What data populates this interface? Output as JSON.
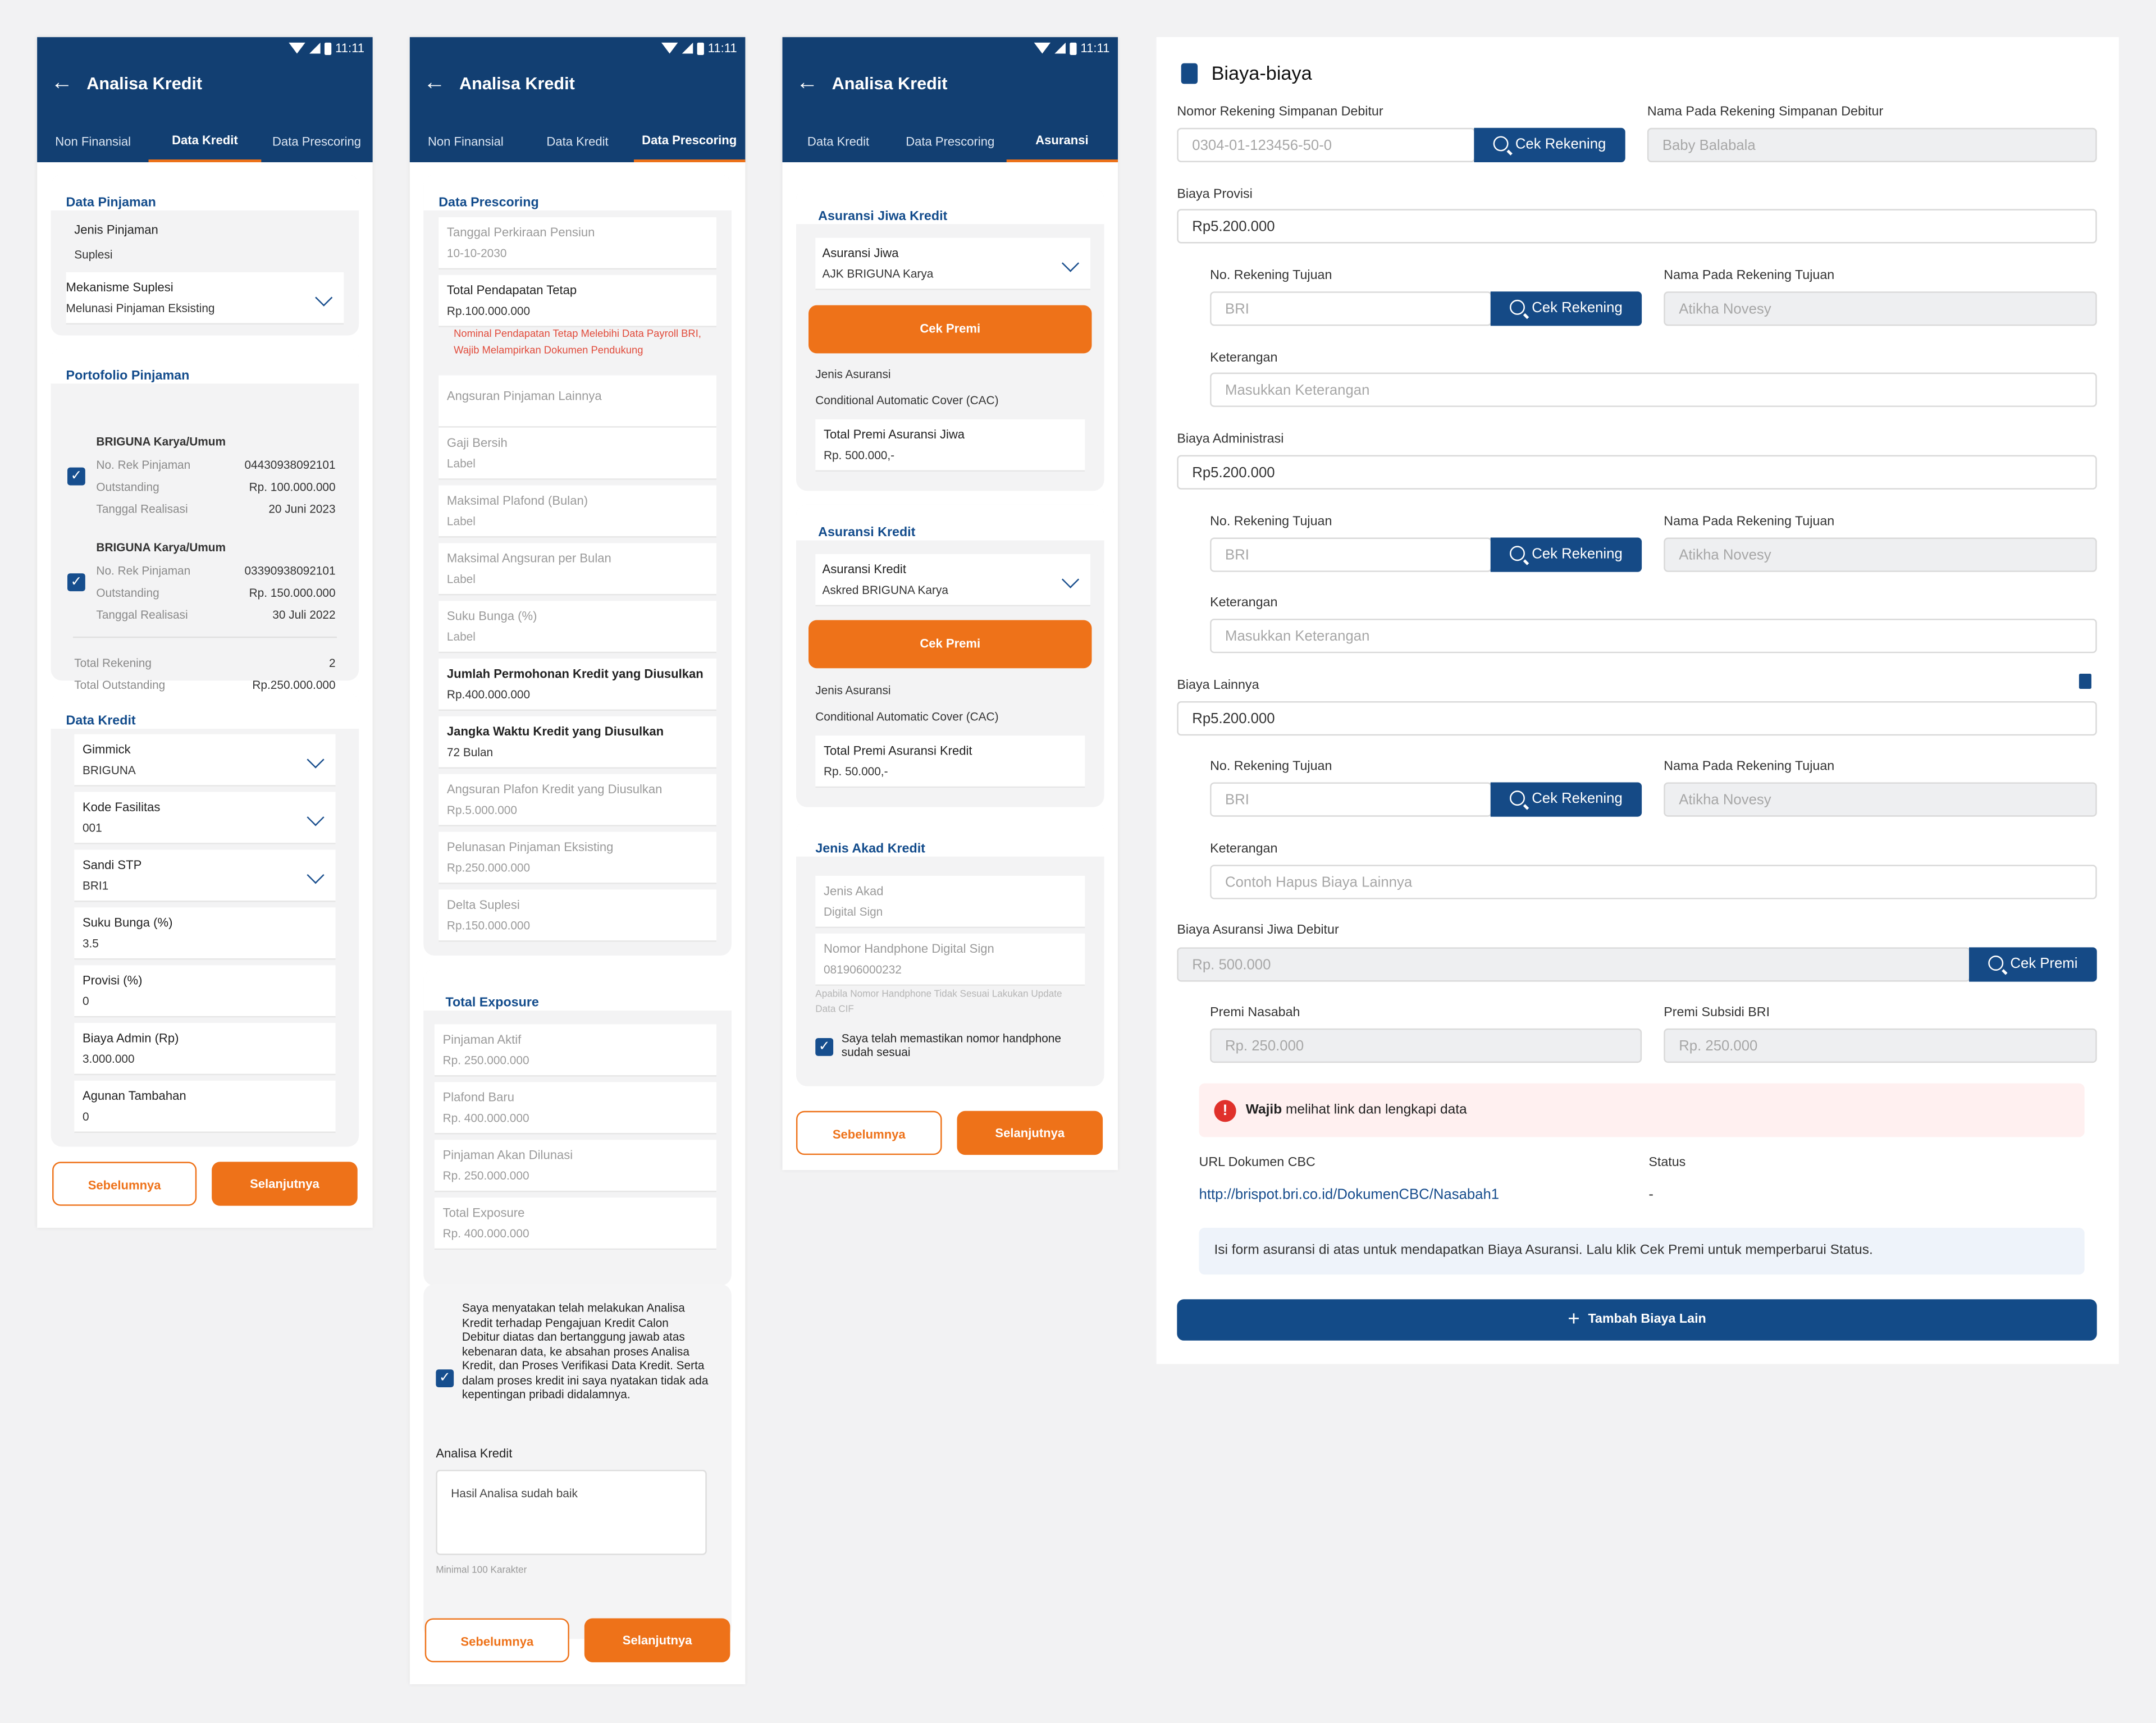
{
  "status_time": "11:11",
  "app_title": "Analisa Kredit",
  "s1": {
    "tabs": [
      "Non Finansial",
      "Data Kredit",
      "Data Prescoring"
    ],
    "data_pinjaman": {
      "title": "Data Pinjaman",
      "jenis_label": "Jenis Pinjaman",
      "jenis_value": "Suplesi",
      "mek_label": "Mekanisme Suplesi",
      "mek_value": "Melunasi Pinjaman Eksisting"
    },
    "portofolio": {
      "title": "Portofolio Pinjaman",
      "items": [
        {
          "name": "BRIGUNA Karya/Umum",
          "no_label": "No. Rek Pinjaman",
          "no": "04430938092101",
          "out_label": "Outstanding",
          "out": "Rp. 100.000.000",
          "tgl_label": "Tanggal Realisasi",
          "tgl": "20 Juni 2023"
        },
        {
          "name": "BRIGUNA Karya/Umum",
          "no_label": "No. Rek Pinjaman",
          "no": "03390938092101",
          "out_label": "Outstanding",
          "out": "Rp. 150.000.000",
          "tgl_label": "Tanggal Realisasi",
          "tgl": "30 Juli 2022"
        }
      ],
      "total_rek_label": "Total Rekening",
      "total_rek": "2",
      "total_out_label": "Total Outstanding",
      "total_out": "Rp.250.000.000"
    },
    "data_kredit": {
      "title": "Data Kredit",
      "fields": [
        {
          "label": "Gimmick",
          "value": "BRIGUNA"
        },
        {
          "label": "Kode Fasilitas",
          "value": "001"
        },
        {
          "label": "Sandi STP",
          "value": "BRI1"
        },
        {
          "label": "Suku Bunga (%)",
          "value": "3.5"
        },
        {
          "label": "Provisi (%)",
          "value": "0"
        },
        {
          "label": "Biaya Admin (Rp)",
          "value": "3.000.000"
        },
        {
          "label": "Agunan Tambahan",
          "value": "0"
        }
      ]
    },
    "btn_prev": "Sebelumnya",
    "btn_next": "Selanjutnya"
  },
  "s2": {
    "tabs": [
      "Non Finansial",
      "Data Kredit",
      "Data Prescoring"
    ],
    "prescoring": {
      "title": "Data Prescoring",
      "fields": [
        {
          "label": "Tanggal Perkiraan Pensiun",
          "value": "10-10-2030"
        },
        {
          "label": "Total Pendapatan Tetap",
          "value": "Rp.100.000.000"
        },
        {
          "label": "Angsuran Pinjaman Lainnya",
          "value": ""
        },
        {
          "label": "Gaji Bersih",
          "value": "Label"
        },
        {
          "label": "Maksimal Plafond (Bulan)",
          "value": "Label"
        },
        {
          "label": "Maksimal Angsuran per Bulan",
          "value": "Label"
        },
        {
          "label": "Suku Bunga (%)",
          "value": "Label"
        },
        {
          "label": "Jumlah Permohonan Kredit yang Diusulkan",
          "value": "Rp.400.000.000"
        },
        {
          "label": "Jangka Waktu Kredit yang Diusulkan",
          "value": "72 Bulan"
        },
        {
          "label": "Angsuran Plafon Kredit yang Diusulkan",
          "value": "Rp.5.000.000"
        },
        {
          "label": "Pelunasan Pinjaman Eksisting",
          "value": "Rp.250.000.000"
        },
        {
          "label": "Delta Suplesi",
          "value": "Rp.150.000.000"
        }
      ],
      "warning": "Nominal Pendapatan Tetap Melebihi Data Payroll BRI, Wajib Melampirkan Dokumen Pendukung"
    },
    "exposure": {
      "title": "Total Exposure",
      "fields": [
        {
          "label": "Pinjaman Aktif",
          "value": "Rp. 250.000.000"
        },
        {
          "label": "Plafond Baru",
          "value": "Rp. 400.000.000"
        },
        {
          "label": "Pinjaman Akan Dilunasi",
          "value": "Rp. 250.000.000"
        },
        {
          "label": "Total Exposure",
          "value": "Rp. 400.000.000"
        }
      ]
    },
    "statement": "Saya menyatakan telah melakukan Analisa Kredit terhadap Pengajuan Kredit Calon Debitur diatas dan bertanggung jawab atas kebenaran data, ke absahan proses Analisa Kredit, dan Proses Verifikasi Data Kredit. Serta dalam proses kredit ini saya nyatakan tidak ada kepentingan pribadi didalamnya.",
    "analisa_label": "Analisa Kredit",
    "analisa_value": "Hasil Analisa sudah baik",
    "analisa_hint": "Minimal 100 Karakter",
    "btn_prev": "Sebelumnya",
    "btn_next": "Selanjutnya"
  },
  "s3": {
    "tabs": [
      "Data Kredit",
      "Data Prescoring",
      "Asuransi"
    ],
    "jiwa": {
      "title": "Asuransi Jiwa Kredit",
      "sel_label": "Asuransi Jiwa",
      "sel_value": "AJK BRIGUNA Karya",
      "btn": "Cek Premi",
      "jenis_label": "Jenis Asuransi",
      "jenis_value": "Conditional Automatic Cover (CAC)",
      "total_label": "Total Premi Asuransi Jiwa",
      "total_value": "Rp. 500.000,-"
    },
    "kredit": {
      "title": "Asuransi Kredit",
      "sel_label": "Asuransi Kredit",
      "sel_value": "Askred BRIGUNA Karya",
      "btn": "Cek Premi",
      "jenis_label": "Jenis Asuransi",
      "jenis_value": "Conditional Automatic Cover (CAC)",
      "total_label": "Total Premi Asuransi Kredit",
      "total_value": "Rp. 50.000,-"
    },
    "akad": {
      "title": "Jenis Akad Kredit",
      "jenis_label": "Jenis Akad",
      "jenis_value": "Digital Sign",
      "hp_label": "Nomor Handphone Digital Sign",
      "hp_value": "081906000232",
      "hp_hint": "Apabila Nomor Handphone Tidak Sesuai Lakukan Update Data CIF",
      "confirm": "Saya telah memastikan nomor handphone sudah sesuai"
    },
    "btn_prev": "Sebelumnya",
    "btn_next": "Selanjutnya"
  },
  "biaya": {
    "title": "Biaya-biaya",
    "rek_label": "Nomor Rekening Simpanan Debitur",
    "rek_value": "0304-01-123456-50-0",
    "cek": "Cek Rekening",
    "nama_label": "Nama Pada Rekening Simpanan Debitur",
    "nama_value": "Baby Balabala",
    "sections": [
      {
        "label": "Biaya Provisi",
        "value": "Rp5.200.000",
        "tujuan_label": "No. Rekening Tujuan",
        "tujuan": "BRI",
        "nama_label": "Nama Pada Rekening Tujuan",
        "nama": "Atikha Novesy",
        "ket_label": "Keterangan",
        "ket": "Masukkan Keterangan"
      },
      {
        "label": "Biaya Administrasi",
        "value": "Rp5.200.000",
        "tujuan_label": "No. Rekening Tujuan",
        "tujuan": "BRI",
        "nama_label": "Nama Pada Rekening Tujuan",
        "nama": "Atikha Novesy",
        "ket_label": "Keterangan",
        "ket": "Masukkan Keterangan"
      },
      {
        "label": "Biaya Lainnya",
        "value": "Rp5.200.000",
        "tujuan_label": "No. Rekening Tujuan",
        "tujuan": "BRI",
        "nama_label": "Nama Pada Rekening Tujuan",
        "nama": "Atikha Novesy",
        "ket_label": "Keterangan",
        "ket": "Contoh Hapus Biaya Lainnya"
      }
    ],
    "asuransi_label": "Biaya Asuransi Jiwa Debitur",
    "asuransi_value": "Rp. 500.000",
    "cek_premi": "Cek Premi",
    "premi_nasabah_label": "Premi Nasabah",
    "premi_nasabah": "Rp. 250.000",
    "premi_subsidi_label": "Premi Subsidi BRI",
    "premi_subsidi": "Rp. 250.000",
    "alert_bold": "Wajib",
    "alert_text": "melihat link dan lengkapi data",
    "url_label": "URL Dokumen CBC",
    "url": "http://brispot.bri.co.id/DokumenCBC/Nasabah1",
    "status_label": "Status",
    "status": "-",
    "info": "Isi form asuransi di atas untuk mendapatkan Biaya Asuransi. Lalu klik Cek Premi untuk memperbarui Status.",
    "add_btn": "Tambah Biaya Lain",
    "colors": {
      "primary": "#134b88",
      "accent": "#ee7219",
      "error": "#e0312b"
    }
  }
}
